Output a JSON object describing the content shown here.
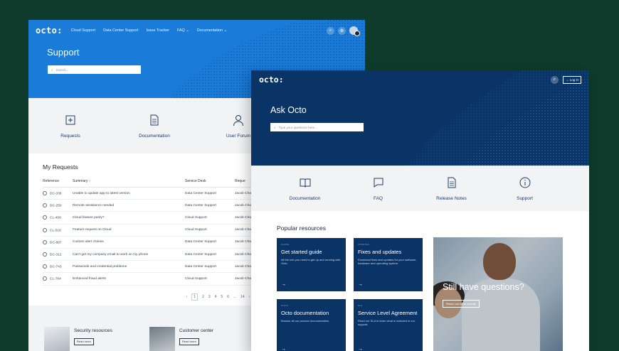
{
  "support": {
    "logo": "octo:",
    "nav": [
      {
        "label": "Cloud Support"
      },
      {
        "label": "Data Center Support"
      },
      {
        "label": "Issue Tracker"
      },
      {
        "label": "FAQ"
      },
      {
        "label": "Documentation"
      }
    ],
    "title": "Support",
    "search_placeholder": "Search...",
    "categories": [
      {
        "label": "Requests",
        "icon": "plus-square-icon"
      },
      {
        "label": "Documentation",
        "icon": "document-icon"
      },
      {
        "label": "User Forum",
        "icon": "user-icon"
      }
    ],
    "requests": {
      "heading": "My Requests",
      "columns": [
        "Reference",
        "Summary",
        "Service Desk",
        "Reque"
      ],
      "rows": [
        {
          "ref": "DC-336",
          "summary": "Unable to update app to latest version",
          "desk": "Data Center Support",
          "req": "Jacob Cha"
        },
        {
          "ref": "DC-250",
          "summary": "Remote assistance needed",
          "desk": "Data Center Support",
          "req": "Jacob Cha"
        },
        {
          "ref": "CL-458",
          "summary": "Cloud feature parity?",
          "desk": "Cloud Support",
          "req": "Jacob Cha"
        },
        {
          "ref": "CL-518",
          "summary": "Feature request on Cloud",
          "desk": "Cloud Support",
          "req": "Jacob Cha"
        },
        {
          "ref": "DC-887",
          "summary": "Custom alert chimes",
          "desk": "Data Center Support",
          "req": "Jacob Cha"
        },
        {
          "ref": "DC-312",
          "summary": "Can't get my company email to work on my phone",
          "desk": "Data Center Support",
          "req": "Jacob Cha"
        },
        {
          "ref": "DC-743",
          "summary": "Passwords and credential problems",
          "desk": "Data Center Support",
          "req": "Jacob Cha"
        },
        {
          "ref": "CL-764",
          "summary": "Enhanced fraud alerts",
          "desk": "Cloud Support",
          "req": "Jacob Cha"
        }
      ],
      "pages": [
        "1",
        "2",
        "3",
        "4",
        "5",
        "6",
        "...",
        "14"
      ]
    },
    "resources": [
      {
        "title": "Security resources",
        "button": "Read more"
      },
      {
        "title": "Customer center",
        "button": "Read more"
      }
    ]
  },
  "ask": {
    "logo": "octo:",
    "login": "Log in",
    "title": "Ask Octo",
    "search_placeholder": "Type your questions here...",
    "categories": [
      {
        "label": "Documentation",
        "icon": "book-icon"
      },
      {
        "label": "FAQ",
        "icon": "chat-icon"
      },
      {
        "label": "Release Notes",
        "icon": "document-icon"
      },
      {
        "label": "Support",
        "icon": "info-icon"
      }
    ],
    "popular_heading": "Popular resources",
    "tiles": [
      {
        "tag": "GUIDE",
        "title": "Get started guide",
        "desc": "All the info you need to get up and running with Octo."
      },
      {
        "tag": "UPDATES",
        "title": "Fixes and updates",
        "desc": "Download fixes and updates for your software, hardware and operating system."
      },
      {
        "tag": "DOCS",
        "title": "Octo documentation",
        "desc": "Browse all our product documentation."
      },
      {
        "tag": "SLA",
        "title": "Service Level Agreement",
        "desc": "Read our SLA to learn what is included in our support."
      }
    ],
    "promo": {
      "title": "Still have questions?",
      "button": "Reach out to us directly"
    }
  }
}
